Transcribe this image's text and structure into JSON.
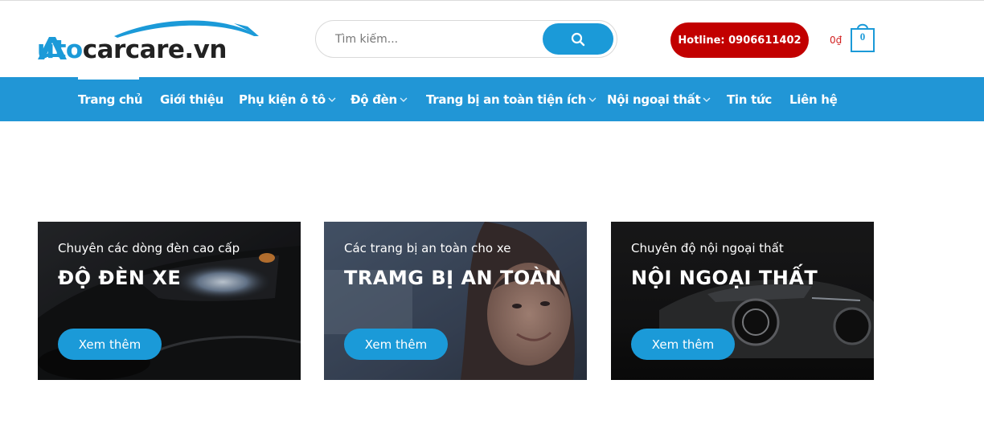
{
  "header": {
    "logo": {
      "text_blue": "uto",
      "text_dark": "carcare.vn",
      "letter": "A"
    },
    "search": {
      "placeholder": "Tìm kiếm..."
    },
    "hotline": "Hotline: 0906611402",
    "cart": {
      "total": "0₫",
      "count": "0"
    }
  },
  "nav": {
    "items": [
      {
        "label": "Trang chủ",
        "active": true,
        "dropdown": false
      },
      {
        "label": "Giới thiệu",
        "dropdown": false
      },
      {
        "label": "Phụ kiện ô tô",
        "dropdown": true
      },
      {
        "label": "Độ đèn",
        "dropdown": true
      },
      {
        "label": "Trang bị an toàn tiện ích",
        "dropdown": true
      },
      {
        "label": "Nội ngoại thất",
        "dropdown": true
      },
      {
        "label": "Tin tức",
        "dropdown": false
      },
      {
        "label": "Liên hệ",
        "dropdown": false
      }
    ]
  },
  "cards": [
    {
      "subtitle": "Chuyên các dòng đèn cao cấp",
      "title": "ĐỘ ĐÈN XE",
      "button": "Xem thêm"
    },
    {
      "subtitle": "Các trang bị an toàn cho xe",
      "title": "TRAMG BỊ AN TOÀN",
      "button": "Xem thêm"
    },
    {
      "subtitle": "Chuyên độ nội ngoại thất",
      "title": "NỘI NGOẠI THẤT",
      "button": "Xem thêm"
    }
  ],
  "colors": {
    "brand_blue": "#1b9ad8",
    "nav_blue": "#2196d6",
    "hotline_red": "#c20000",
    "price_red": "#d21f1f"
  }
}
